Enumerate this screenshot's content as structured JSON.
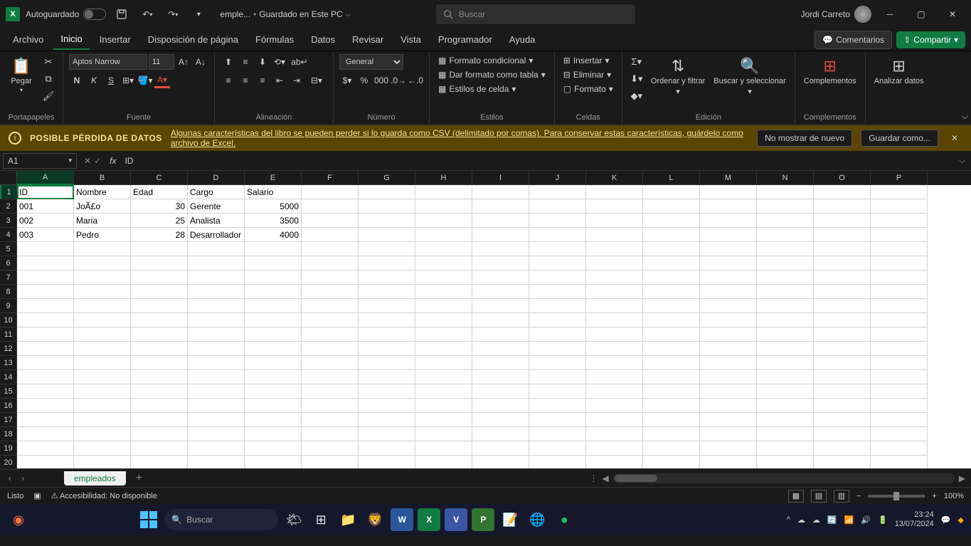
{
  "titlebar": {
    "autosave_label": "Autoguardado",
    "filename": "emple...",
    "save_status": "Guardado en Este PC",
    "search_placeholder": "Buscar",
    "user_name": "Jordi Carreto"
  },
  "tabs": {
    "archivo": "Archivo",
    "inicio": "Inicio",
    "insertar": "Insertar",
    "disposicion": "Disposición de página",
    "formulas": "Fórmulas",
    "datos": "Datos",
    "revisar": "Revisar",
    "vista": "Vista",
    "programador": "Programador",
    "ayuda": "Ayuda",
    "comentarios": "Comentarios",
    "compartir": "Compartir"
  },
  "ribbon": {
    "portapapeles": {
      "label": "Portapapeles",
      "pegar": "Pegar"
    },
    "fuente": {
      "label": "Fuente",
      "font_name": "Aptos Narrow",
      "font_size": "11"
    },
    "alineacion": {
      "label": "Alineación"
    },
    "numero": {
      "label": "Número",
      "format": "General"
    },
    "estilos": {
      "label": "Estilos",
      "cond": "Formato condicional",
      "tabla": "Dar formato como tabla",
      "celda": "Estilos de celda"
    },
    "celdas": {
      "label": "Celdas",
      "insertar": "Insertar",
      "eliminar": "Eliminar",
      "formato": "Formato"
    },
    "edicion": {
      "label": "Edición",
      "ordenar": "Ordenar y filtrar",
      "buscar": "Buscar y seleccionar"
    },
    "complementos": {
      "label": "Complementos",
      "btn": "Complementos"
    },
    "analizar": {
      "label": "",
      "btn": "Analizar datos"
    }
  },
  "warning": {
    "title": "POSIBLE PÉRDIDA DE DATOS",
    "text": "Algunas características del libro se pueden perder si lo guarda como CSV (delimitado por comas). Para conservar estas características, guárdelo como archivo de Excel.",
    "no_mostrar": "No mostrar de nuevo",
    "guardar": "Guardar como..."
  },
  "formula_bar": {
    "cell_ref": "A1",
    "value": "ID"
  },
  "grid": {
    "columns": [
      "A",
      "B",
      "C",
      "D",
      "E",
      "F",
      "G",
      "H",
      "I",
      "J",
      "K",
      "L",
      "M",
      "N",
      "O",
      "P"
    ],
    "headers": [
      "ID",
      "Nombre",
      "Edad",
      "Cargo",
      "Salario"
    ],
    "rows": [
      {
        "id": "001",
        "nombre": "JoÃ£o",
        "edad": "30",
        "cargo": "Gerente",
        "salario": "5000"
      },
      {
        "id": "002",
        "nombre": "Maria",
        "edad": "25",
        "cargo": "Analista",
        "salario": "3500"
      },
      {
        "id": "003",
        "nombre": "Pedro",
        "edad": "28",
        "cargo": "Desarrollador",
        "salario": "4000"
      }
    ],
    "selected_cell": "A1"
  },
  "sheet": {
    "name": "empleados"
  },
  "statusbar": {
    "ready": "Listo",
    "accessibility": "Accesibilidad: No disponible",
    "zoom": "100%"
  },
  "taskbar": {
    "search": "Buscar",
    "time": "23:24",
    "date": "13/07/2024"
  }
}
